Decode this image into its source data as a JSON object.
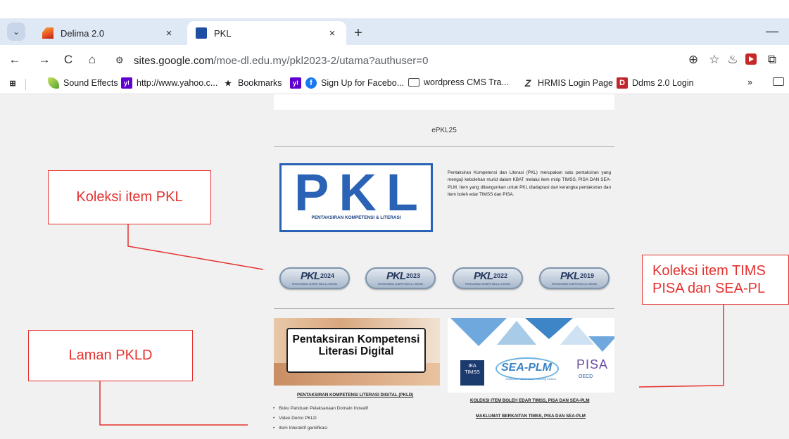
{
  "tabs": [
    {
      "label": "Delima 2.0",
      "close": "×"
    },
    {
      "label": "PKL",
      "close": "×"
    }
  ],
  "new_tab": "+",
  "window": {
    "minimize": "—"
  },
  "toolbar": {
    "back": "←",
    "forward": "→",
    "reload": "C",
    "home": "⌂",
    "site_info": "⚙",
    "url_host": "sites.google.com",
    "url_path": "/moe-dl.edu.my/pkl2023-2/utama?authuser=0",
    "zoom": "⊕",
    "star": "☆",
    "extension": "♨",
    "puzzle": "⧉"
  },
  "bookmarks": {
    "apps": "⊞",
    "items": [
      "Sound Effects",
      "http://www.yahoo.c...",
      "Bookmarks",
      "Sign Up for Facebo...",
      "wordpress CMS Tra...",
      "HRMIS Login Page",
      "Ddms 2.0 Login"
    ],
    "more": "»"
  },
  "site": {
    "title": "ePKL25",
    "logo_letters": "PKL",
    "logo_subtitle": "PENTAKSIRAN KOMPETENSI & LITERASI",
    "description": "Pentaksiran Kompetensi dan Literasi (PKL) merupakan satu pentaksiran yang menguji kebolehan murid dalam KBAT melalui item mirip TIMSS, PISA DAN SEA-PLM. Item yang dibangunkan untuk PKL diadaptasi dari kerangka pentaksiran dan item boleh edar TIMSS dan PISA.",
    "pills": [
      {
        "logo": "PKL",
        "year": "2024",
        "sub": "PENTAKSIRAN KOMPETENSI & LITERASI"
      },
      {
        "logo": "PKL",
        "year": "2023",
        "sub": "PENTAKSIRAN KOMPETENSI & LITERASI"
      },
      {
        "logo": "PKL",
        "year": "2022",
        "sub": "PENTAKSIRAN KOMPETENSI & LITERASI"
      },
      {
        "logo": "PKL",
        "year": "2019",
        "sub": "PENTAKSIRAN KOMPETENSI & LITERASI"
      }
    ],
    "pkld_card_text": "Pentaksiran Kompetensi Literasi Digital",
    "pkld_link": "PENTAKSIRAN KOMPETENSI LITERASI DIGITAL (PKLD)",
    "pkld_bullets": [
      "Buku Panduan Pelaksanaan Domain Inovatif",
      "Video Demo PKLD",
      "Item Interaktif gamifikasi"
    ],
    "timss_logo": "IEA TIMSS",
    "seaplm": "SEA-PLM",
    "seaplm_sub": "Southeast Asia Primary Learning Metrics",
    "pisa": "PISA",
    "oecd": "OECD",
    "timss_link": "KOLEKSI ITEM BOLEH EDAR TIMSS, PISA DAN SEA-PLM",
    "timss_info_link": "MAKLUMAT BERKAITAN TIMSS, PISA DAN SEA-PLM"
  },
  "annotations": {
    "koleksi_pkl": "Koleksi item PKL",
    "laman_pkld": "Laman PKLD",
    "koleksi_timss_line1": "Koleksi item TIMS",
    "koleksi_timss_line2": "PISA dan SEA-PL"
  },
  "colors": {
    "annotation": "#e5322f",
    "pkl_blue": "#2a62b5",
    "tabstrip": "#dfe8f5"
  }
}
